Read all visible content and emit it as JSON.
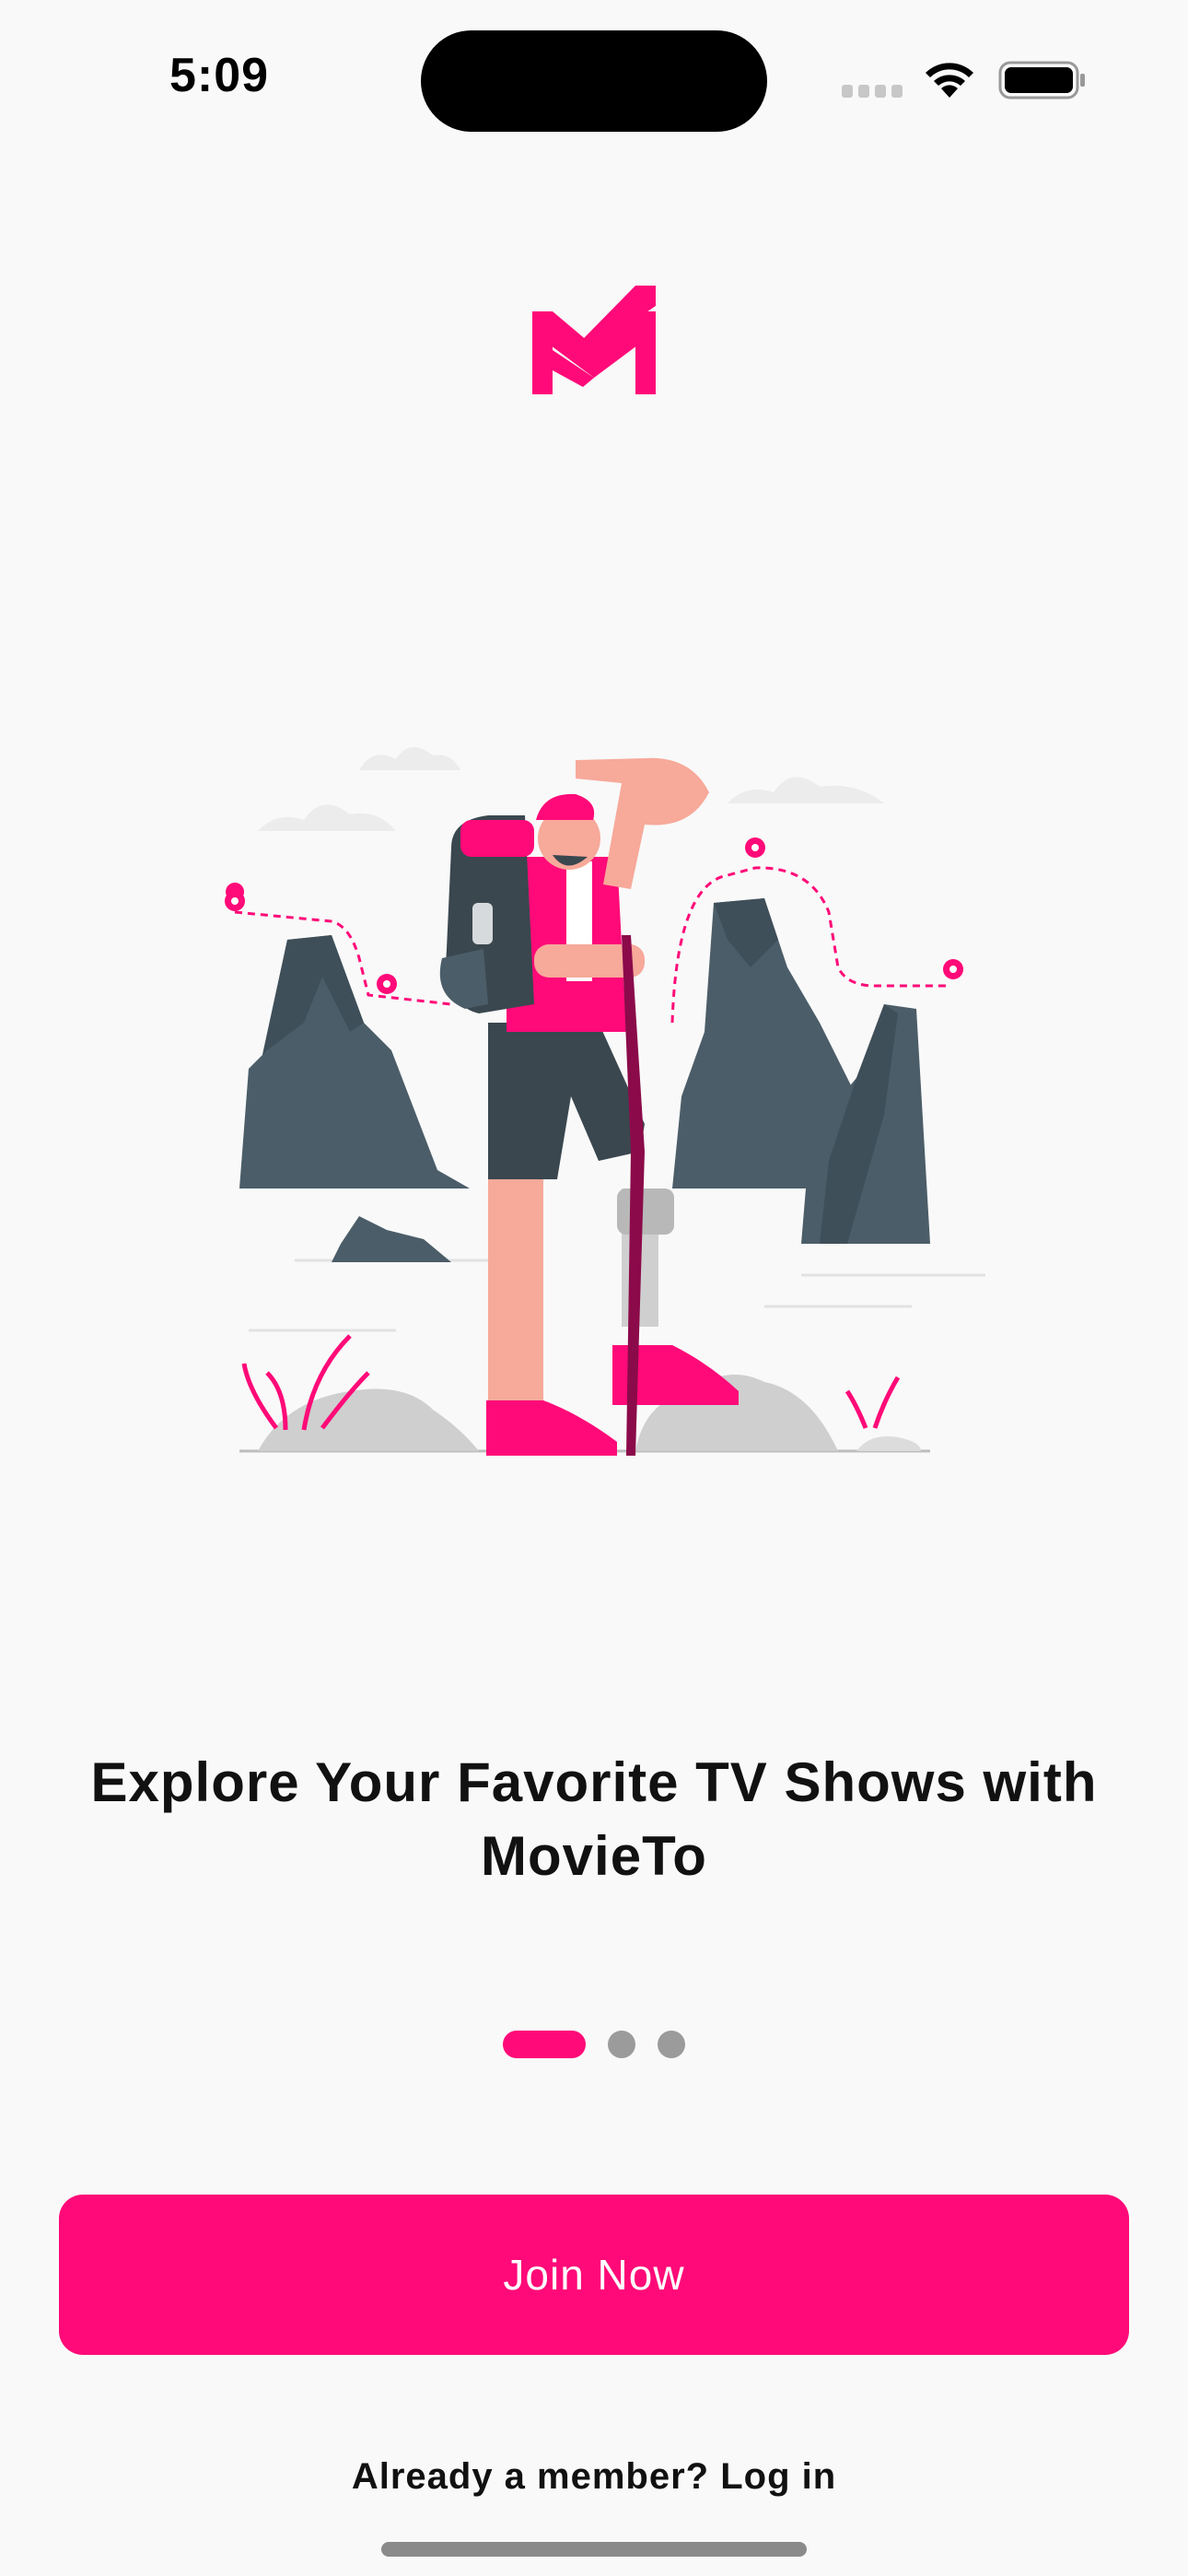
{
  "status_bar": {
    "time": "5:09",
    "icons": [
      "cellular-signal-icon",
      "wifi-icon",
      "battery-icon"
    ]
  },
  "brand": {
    "logo_icon": "movieto-logo-icon",
    "accent_color": "#ff0a78"
  },
  "onboarding": {
    "illustration": "hiker-with-backpack-illustration",
    "headline": "Explore Your Favorite TV Shows with MovieTo",
    "page_indicator": {
      "total": 3,
      "active_index": 0
    }
  },
  "actions": {
    "join_label": "Join Now",
    "login_label": "Already a member? Log in"
  }
}
